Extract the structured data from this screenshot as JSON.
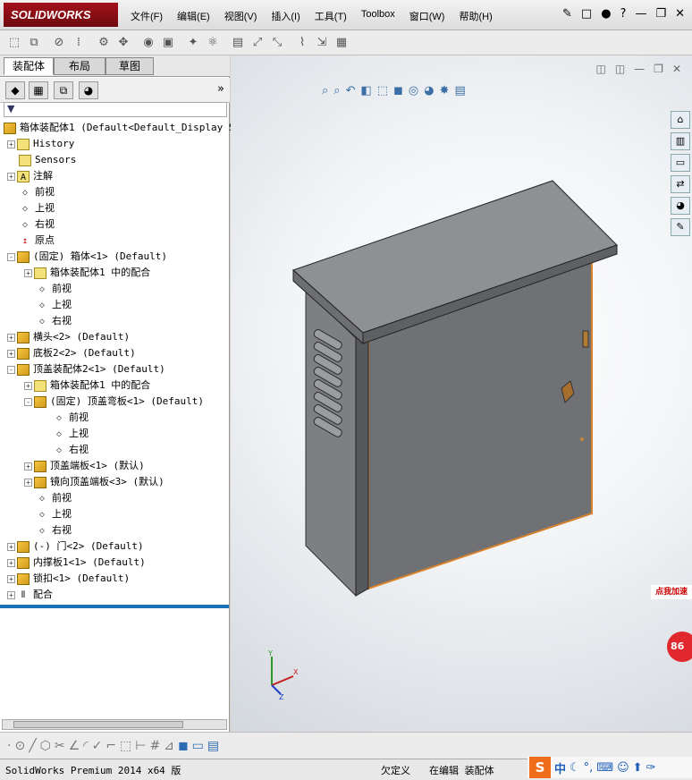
{
  "app": {
    "logo": "SOLIDWORKS"
  },
  "menu": [
    "文件(F)",
    "编辑(E)",
    "视图(V)",
    "插入(I)",
    "工具(T)",
    "Toolbox",
    "窗口(W)",
    "帮助(H)"
  ],
  "window_controls": {
    "minimize": "—",
    "restore": "❐",
    "close": "✕"
  },
  "tabs": [
    "装配体",
    "布局",
    "草图"
  ],
  "feature_manager_tabs": [
    "feature-tree",
    "property-manager",
    "configuration-manager",
    "display-manager"
  ],
  "filter_icon": "filter-icon",
  "tree": [
    {
      "label": "箱体装配体1  (Default<Default_Display S",
      "icon": "asm",
      "expander": ""
    },
    {
      "label": "History",
      "icon": "folder",
      "expander": "+"
    },
    {
      "label": "Sensors",
      "icon": "folder",
      "expander": ""
    },
    {
      "label": "注解",
      "icon": "annot",
      "expander": "+"
    },
    {
      "label": "前视",
      "icon": "plane",
      "expander": ""
    },
    {
      "label": "上视",
      "icon": "plane",
      "expander": ""
    },
    {
      "label": "右视",
      "icon": "plane",
      "expander": ""
    },
    {
      "label": "原点",
      "icon": "origin",
      "expander": ""
    },
    {
      "label": "(固定) 箱体<1> (Default)",
      "icon": "asm",
      "expander": "-"
    },
    {
      "label": "箱体装配体1 中的配合",
      "icon": "folder",
      "expander": "+"
    },
    {
      "label": "前视",
      "icon": "plane",
      "expander": ""
    },
    {
      "label": "上视",
      "icon": "plane",
      "expander": ""
    },
    {
      "label": "右视",
      "icon": "plane",
      "expander": ""
    },
    {
      "label": "横头<2> (Default)",
      "icon": "asm",
      "expander": "+"
    },
    {
      "label": "底板2<2> (Default)",
      "icon": "asm",
      "expander": "+"
    },
    {
      "label": "顶盖装配体2<1> (Default)",
      "icon": "asm",
      "expander": "-"
    },
    {
      "label": "箱体装配体1 中的配合",
      "icon": "folder",
      "expander": "+"
    },
    {
      "label": "(固定) 顶盖弯板<1> (Default)",
      "icon": "asm",
      "expander": "-"
    },
    {
      "label": "前视",
      "icon": "plane",
      "expander": ""
    },
    {
      "label": "上视",
      "icon": "plane",
      "expander": ""
    },
    {
      "label": "右视",
      "icon": "plane",
      "expander": ""
    },
    {
      "label": "顶盖端板<1> (默认)",
      "icon": "asm",
      "expander": "+"
    },
    {
      "label": "镜向顶盖端板<3> (默认)",
      "icon": "asm",
      "expander": "+"
    },
    {
      "label": "前视",
      "icon": "plane",
      "expander": ""
    },
    {
      "label": "上视",
      "icon": "plane",
      "expander": ""
    },
    {
      "label": "右视",
      "icon": "plane",
      "expander": ""
    },
    {
      "label": "(-) 门<2> (Default)",
      "icon": "asm",
      "expander": "+"
    },
    {
      "label": "内撑板1<1> (Default)",
      "icon": "asm",
      "expander": "+"
    },
    {
      "label": "锁扣<1> (Default)",
      "icon": "asm",
      "expander": "+"
    },
    {
      "label": "配合",
      "icon": "mates",
      "expander": "+"
    }
  ],
  "ad": {
    "label": "点我加速",
    "number": "86"
  },
  "triad": {
    "x": "X",
    "y": "Y",
    "z": "Z"
  },
  "status": {
    "product": "SolidWorks Premium 2014 x64 版",
    "defined": "欠定义",
    "mode": "在编辑 装配体"
  },
  "ime": {
    "logo": "S",
    "lang": "中"
  }
}
